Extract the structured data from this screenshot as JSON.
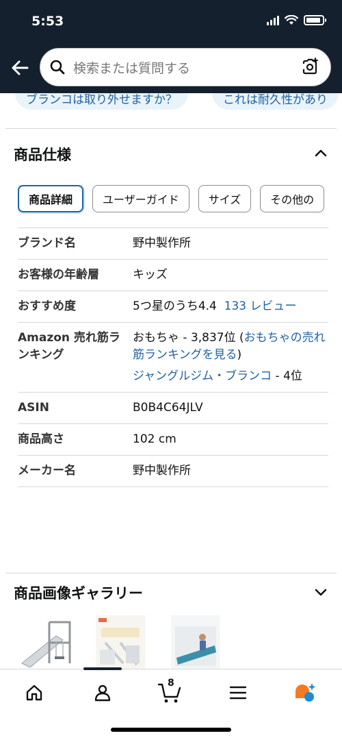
{
  "status_bar": {
    "time": "5:53"
  },
  "header": {
    "search_placeholder": "検索または質問する"
  },
  "question_chips": [
    "ブランコは取り外せますか？",
    "これは耐久性があり"
  ],
  "spec_section": {
    "title": "商品仕様",
    "tabs": [
      "商品詳細",
      "ユーザーガイド",
      "サイズ",
      "その他の"
    ],
    "active_tab": "商品詳細",
    "rows": {
      "brand": {
        "key": "ブランド名",
        "value": "野中製作所"
      },
      "age": {
        "key": "お客様の年齢層",
        "value": "キッズ"
      },
      "rating": {
        "key": "おすすめ度",
        "value": "5つ星のうち4.4",
        "review_link": "133 レビュー"
      },
      "ranking": {
        "key": "Amazon 売れ筋ランキング",
        "value_prefix": "おもちゃ - 3,837位 (",
        "value_link": "おもちゃの売れ筋ランキングを見る",
        "value_suffix": ")",
        "sub_link": "ジャングルジム・ブランコ",
        "sub_rank": " - 4位"
      },
      "asin": {
        "key": "ASIN",
        "value": "B0B4C64JLV"
      },
      "height": {
        "key": "商品高さ",
        "value": "102 cm"
      },
      "maker": {
        "key": "メーカー名",
        "value": "野中製作所"
      }
    }
  },
  "gallery_section": {
    "title": "商品画像ギャラリー"
  },
  "bottom_nav": {
    "items": [
      "home-icon",
      "account-icon",
      "cart-icon",
      "menu-icon",
      "rufus-icon"
    ],
    "cart_count": "8"
  },
  "colors": {
    "header_bg": "#14202d",
    "link": "#2162a1",
    "active_tab_border": "#2162a1",
    "chip_bg": "#e8f3fa"
  }
}
